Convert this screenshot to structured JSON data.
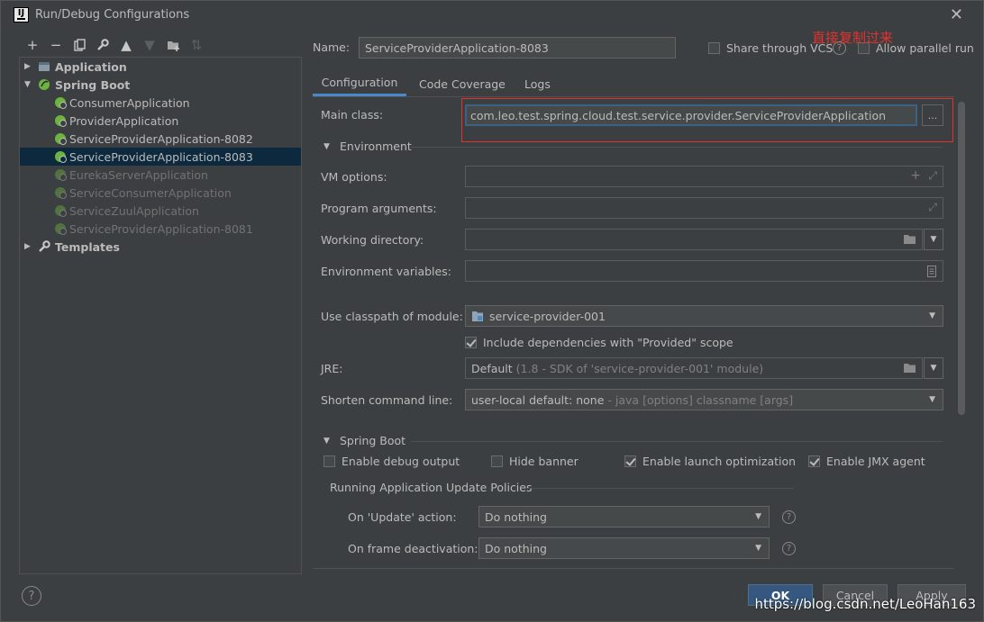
{
  "window": {
    "title": "Run/Debug Configurations"
  },
  "toolbar": {
    "icons": [
      "add-icon",
      "remove-icon",
      "copy-icon",
      "wrench-icon",
      "arrow-up-icon",
      "arrow-down-icon",
      "folder-add-icon",
      "sort-icon"
    ]
  },
  "tree": {
    "application": "Application",
    "spring_boot": "Spring Boot",
    "items": [
      "ConsumerApplication",
      "ProviderApplication",
      "ServiceProviderApplication-8082",
      "ServiceProviderApplication-8083",
      "EurekaServerApplication",
      "ServiceConsumerApplication",
      "ServiceZuulApplication",
      "ServiceProviderApplication-8081"
    ],
    "templates": "Templates"
  },
  "name": {
    "label": "Name:",
    "value": "ServiceProviderApplication-8083"
  },
  "share_vcs": "Share through VCS",
  "allow_parallel": "Allow parallel run",
  "annotation": "直接复制过来",
  "tabs": [
    "Configuration",
    "Code Coverage",
    "Logs"
  ],
  "main_class": {
    "label": "Main class:",
    "value": "com.leo.test.spring.cloud.test.service.provider.ServiceProviderApplication",
    "browse": "..."
  },
  "environment": {
    "header": "Environment",
    "vm_options": "VM options:",
    "program_arguments": "Program arguments:",
    "working_directory": "Working directory:",
    "environment_variables": "Environment variables:",
    "classpath_label": "Use classpath of module:",
    "classpath_value": "service-provider-001",
    "include_deps": "Include dependencies with \"Provided\" scope",
    "jre_label": "JRE:",
    "jre_value": "Default",
    "jre_hint": "(1.8 - SDK of 'service-provider-001' module)",
    "shorten_label": "Shorten command line:",
    "shorten_value": "user-local default: none",
    "shorten_hint": "- java [options] classname [args]"
  },
  "spring_boot_section": {
    "header": "Spring Boot",
    "enable_debug": "Enable debug output",
    "hide_banner": "Hide banner",
    "launch_opt": "Enable launch optimization",
    "jmx": "Enable JMX agent",
    "policies_header": "Running Application Update Policies",
    "update_label": "On 'Update' action:",
    "update_value": "Do nothing",
    "frame_label": "On frame deactivation:",
    "frame_value": "Do nothing"
  },
  "buttons": {
    "ok": "OK",
    "cancel": "Cancel",
    "apply": "Apply",
    "help": "?"
  },
  "watermark": "https://blog.csdn.net/LeoHan163",
  "colors": {
    "accent": "#4a88c7",
    "selection": "#0d293e",
    "annotation": "#e0332e"
  }
}
